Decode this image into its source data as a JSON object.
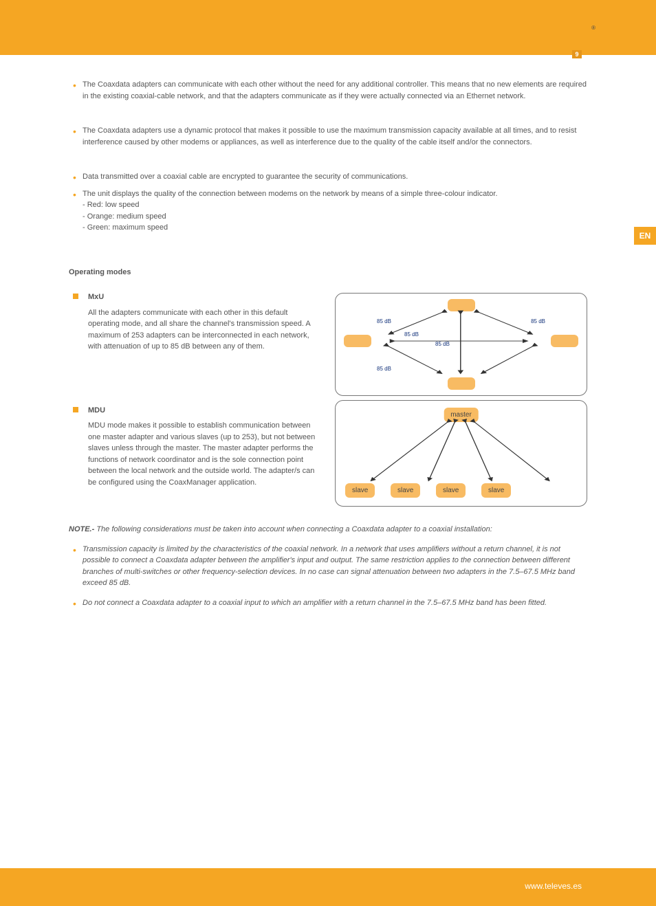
{
  "header": {
    "reg_mark": "®"
  },
  "page_number": "9",
  "lang_tab": "EN",
  "bullets_top": [
    "The Coaxdata adapters can communicate with each other without the need for any additional controller. This means that no new elements are required in the existing coaxial-cable network, and that the adapters communicate as if they were actually connected via an Ethernet network.",
    "The Coaxdata adapters use a dynamic protocol that makes it possible to use the maximum transmission capacity available at all times, and to resist interference caused by other modems or appliances, as well as interference due to the quality of the cable itself and/or the connectors.",
    "Data transmitted over a coaxial cable are encrypted to guarantee the security of communications.",
    "The unit displays the quality of the connection between modems on the network by means of a simple three-colour indicator.\n- Red: low speed\n- Orange: medium speed\n- Green: maximum speed"
  ],
  "mode": {
    "title": "Operating modes",
    "mxu": {
      "title": "MxU",
      "text": "All the adapters communicate with each other in this default operating mode, and all share the channel's transmission speed. A maximum of 253 adapters can be interconnected in each network, with attenuation of up to 85 dB between any of them."
    },
    "mdu": {
      "title": "MDU",
      "text": "MDU mode makes it possible to establish communication between one master adapter and various slaves (up to 253), but not between slaves unless through the master. The master adapter performs the functions of network coordinator and is the sole connection point between the local network and the outside world. The adapter/s can be configured using the CoaxManager application."
    }
  },
  "warn_section": {
    "prefix": "NOTE.-",
    "text": " The following considerations must be taken into account when connecting a Coaxdata adapter to a coaxial installation:",
    "items": [
      "Transmission capacity is limited by the characteristics of the coaxial network. In a network that uses amplifiers without a return channel, it is not possible to connect a Coaxdata adapter between the amplifier's input and output. The same restriction applies to the connection between different branches of multi-switches or other frequency-selection devices. In no case can signal attenuation between two adapters in the 7.5–67.5 MHz band exceed 85 dB.",
      "Do not connect a Coaxdata adapter to a coaxial input to which an amplifier with a return channel in the 7.5–67.5 MHz band has been fitted."
    ]
  },
  "diagram1": {
    "labels": [
      "85 dB",
      "85 dB",
      "85 dB",
      "85 dB",
      "85 dB"
    ]
  },
  "diagram2": {
    "master": "master",
    "slaves": [
      "slave",
      "slave",
      "slave",
      "slave"
    ]
  },
  "footer": "www.televes.es"
}
